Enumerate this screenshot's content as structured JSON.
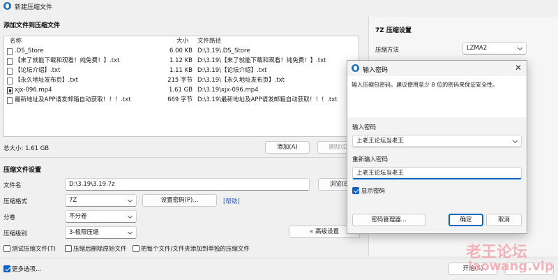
{
  "window": {
    "title": "新建压缩文件"
  },
  "files_section": {
    "title": "添加文件到压缩文件",
    "columns": {
      "name": "名称",
      "size": "大小",
      "path": "文件路径"
    },
    "rows": [
      {
        "name": ".DS_Store",
        "size": "6.00 KB",
        "path": "D:\\3.19\\.DS_Store",
        "icon": "file-icon"
      },
      {
        "name": "【来了就能下载和观看！纯免费！】.txt",
        "size": "1.12 KB",
        "path": "D:\\3.19\\【来了就能下载和观看！纯免费！】.txt",
        "icon": "file-icon"
      },
      {
        "name": "【论坛介绍】.txt",
        "size": "1.11 KB",
        "path": "D:\\3.19\\【论坛介绍】.txt",
        "icon": "file-icon"
      },
      {
        "name": "【永久地址发布页】.txt",
        "size": "215 字节",
        "path": "D:\\3.19\\【永久地址发布页】.txt",
        "icon": "file-icon"
      },
      {
        "name": "xjx-096.mp4",
        "size": "1.61 GB",
        "path": "D:\\3.19\\xjx-096.mp4",
        "icon": "video-file-icon"
      },
      {
        "name": "最新地址及APP请发邮箱自动获取！！！.txt",
        "size": "669 字节",
        "path": "D:\\3.19\\最新地址及APP请发邮箱自动获取！！！.txt",
        "icon": "file-icon"
      }
    ],
    "total": "总大小: 1.61 GB",
    "add_label": "添加(A)",
    "delete_label": "删除(D"
  },
  "settings_section": {
    "title": "压缩文件设置",
    "filename_label": "文件名",
    "filename_value": "D:\\3.19\\3.19.7z",
    "browse_label": "浏览(B",
    "format_label": "压缩格式",
    "format_value": "7Z",
    "set_password_label": "设置密码(P)...",
    "help_label": "[帮助]",
    "split_label": "分卷",
    "split_value": "不分卷",
    "level_label": "压缩级别",
    "level_value": "3-极限压缩",
    "advanced_label": "« 高级设置",
    "opt_test": "测试压缩文件(T)",
    "opt_delete": "压缩后删除原始文件",
    "opt_separate": "把每个文件/文件夹添加到单独的压缩文件",
    "more_options": "更多选项...",
    "start_label": "开始(S)"
  },
  "right_panel": {
    "title": "7Z 压缩设置",
    "method_label": "压缩方法",
    "method_value": "LZMA2"
  },
  "password_dialog": {
    "title": "输入密码",
    "hint": "输入压缩包密码。建议使用至少 8 位的密码来保证安全性。",
    "password_label": "输入密码",
    "password_value": "上老王论坛当老王",
    "confirm_label": "重新输入密码",
    "confirm_value": "上老王论坛当老王",
    "show_password": "显示密码",
    "manager_label": "密码管理器...",
    "ok_label": "确定",
    "cancel_label": "取消"
  },
  "watermark": {
    "cn": "老王论坛",
    "en": "laowang.vip"
  },
  "colors": {
    "accent": "#0067c0",
    "watermark": "#f2a7b0"
  }
}
